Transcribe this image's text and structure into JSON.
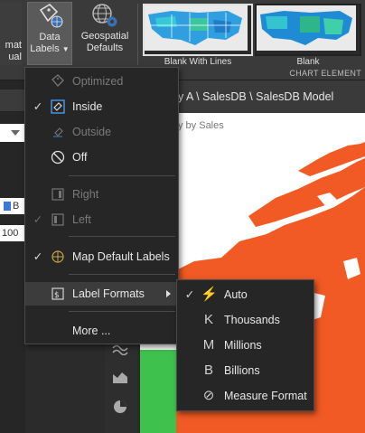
{
  "ribbon": {
    "left_partial_line1": "mat",
    "left_partial_line2": "ual",
    "data_labels_line1": "Data",
    "data_labels_line2": "Labels",
    "geo_line1": "Geospatial",
    "geo_line2": "Defaults",
    "gallery": [
      {
        "label": "Blank With Lines"
      },
      {
        "label": "Blank"
      }
    ],
    "section_label": "CHART ELEMENT"
  },
  "left_pane": {
    "field_b": "B",
    "field_100": "100"
  },
  "content": {
    "title": "y A \\ SalesDB \\ SalesDB Model",
    "subtitle": "y by Sales"
  },
  "menu": {
    "items": [
      {
        "label": "Optimized",
        "checked": false,
        "disabled": true,
        "icon": "tag-optimized-icon"
      },
      {
        "label": "Inside",
        "checked": true,
        "disabled": false,
        "icon": "tag-inside-icon"
      },
      {
        "label": "Outside",
        "checked": false,
        "disabled": true,
        "icon": "tag-outside-icon"
      },
      {
        "label": "Off",
        "checked": false,
        "disabled": false,
        "icon": "off-circle-icon"
      },
      {
        "label": "Right",
        "checked": false,
        "disabled": true,
        "icon": "align-right-icon"
      },
      {
        "label": "Left",
        "checked": true,
        "disabled": true,
        "icon": "align-left-icon"
      },
      {
        "label": "Map Default Labels",
        "checked": true,
        "disabled": false,
        "icon": "map-labels-icon"
      },
      {
        "label": "Label Formats",
        "checked": false,
        "disabled": false,
        "icon": "label-format-icon"
      },
      {
        "label": "More ...",
        "checked": false,
        "disabled": false,
        "icon": ""
      }
    ]
  },
  "submenu": {
    "items": [
      {
        "label": "Auto",
        "glyph": "⚡",
        "checked": true,
        "icon": "lightning-icon"
      },
      {
        "label": "Thousands",
        "glyph": "K",
        "checked": false,
        "icon": "k-icon"
      },
      {
        "label": "Millions",
        "glyph": "M",
        "checked": false,
        "icon": "m-icon"
      },
      {
        "label": "Billions",
        "glyph": "B",
        "checked": false,
        "icon": "b-icon"
      },
      {
        "label": "Measure Format",
        "glyph": "⊘",
        "checked": false,
        "icon": "measure-format-icon"
      }
    ]
  },
  "colors": {
    "map_fill": "#f15a24",
    "accent_blue": "#4aa3ff",
    "menu_bg": "#262626"
  }
}
